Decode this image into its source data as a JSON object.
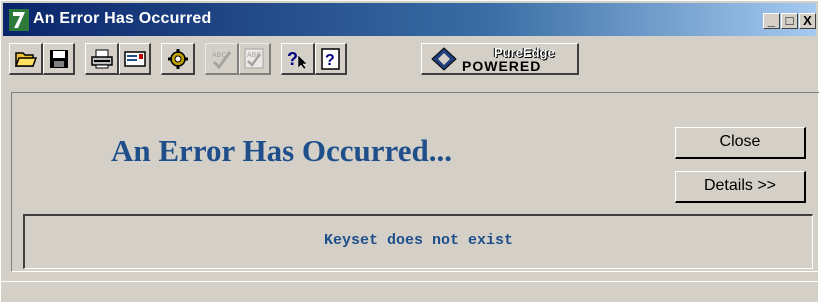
{
  "window": {
    "title": "An Error Has Occurred",
    "controls": [
      "_",
      "□",
      "X"
    ]
  },
  "toolbar": {
    "buttons": [
      {
        "name": "open-icon"
      },
      {
        "name": "save-icon"
      },
      {
        "name": "print-icon"
      },
      {
        "name": "email-icon"
      },
      {
        "name": "settings-icon"
      },
      {
        "name": "spellcheck-icon"
      },
      {
        "name": "spellcheck-all-icon"
      },
      {
        "name": "help-pointer-icon"
      },
      {
        "name": "help-icon"
      }
    ],
    "brand": {
      "line1": "PureEdge",
      "line2": "POWERED"
    }
  },
  "dialog": {
    "heading": "An Error Has Occurred...",
    "close_label": "Close",
    "details_label": "Details >>",
    "message": "Keyset does not exist"
  },
  "colors": {
    "heading": "#1f4f8a",
    "titlebar": "#0a246a"
  }
}
